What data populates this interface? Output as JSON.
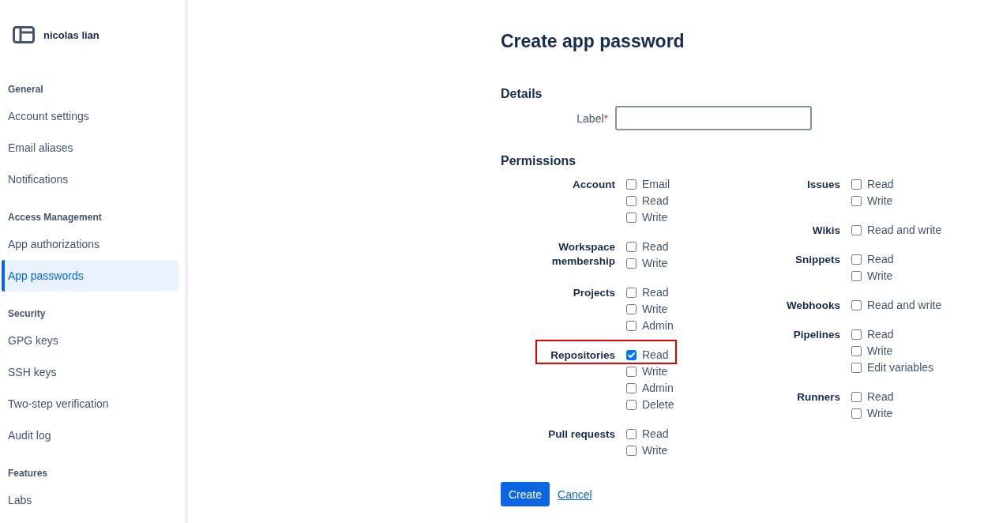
{
  "sidebar": {
    "user": {
      "name": "nicolas lian"
    },
    "sections": [
      {
        "title": "General",
        "items": [
          {
            "label": "Account settings",
            "selected": false
          },
          {
            "label": "Email aliases",
            "selected": false
          },
          {
            "label": "Notifications",
            "selected": false
          }
        ]
      },
      {
        "title": "Access Management",
        "items": [
          {
            "label": "App authorizations",
            "selected": false
          },
          {
            "label": "App passwords",
            "selected": true
          }
        ]
      },
      {
        "title": "Security",
        "items": [
          {
            "label": "GPG keys",
            "selected": false
          },
          {
            "label": "SSH keys",
            "selected": false
          },
          {
            "label": "Two-step verification",
            "selected": false
          },
          {
            "label": "Audit log",
            "selected": false
          }
        ]
      },
      {
        "title": "Features",
        "items": [
          {
            "label": "Labs",
            "selected": false
          }
        ]
      }
    ]
  },
  "form": {
    "title": "Create app password",
    "details": {
      "heading": "Details",
      "field": {
        "label": "Label",
        "required_mark": "*"
      }
    },
    "permissions": {
      "heading": "Permissions",
      "columns": [
        {
          "groups": [
            {
              "name": "Account",
              "highlighted": false,
              "options": [
                {
                  "label": "Email",
                  "checked": false
                },
                {
                  "label": "Read",
                  "checked": false
                },
                {
                  "label": "Write",
                  "checked": false
                }
              ]
            },
            {
              "name": "Workspace membership",
              "highlighted": false,
              "options": [
                {
                  "label": "Read",
                  "checked": false
                },
                {
                  "label": "Write",
                  "checked": false
                }
              ]
            },
            {
              "name": "Projects",
              "highlighted": false,
              "options": [
                {
                  "label": "Read",
                  "checked": false
                },
                {
                  "label": "Write",
                  "checked": false
                },
                {
                  "label": "Admin",
                  "checked": false
                }
              ]
            },
            {
              "name": "Repositories",
              "highlighted": true,
              "options": [
                {
                  "label": "Read",
                  "checked": true
                },
                {
                  "label": "Write",
                  "checked": false
                },
                {
                  "label": "Admin",
                  "checked": false
                },
                {
                  "label": "Delete",
                  "checked": false
                }
              ]
            },
            {
              "name": "Pull requests",
              "highlighted": false,
              "options": [
                {
                  "label": "Read",
                  "checked": false
                },
                {
                  "label": "Write",
                  "checked": false
                }
              ]
            }
          ]
        },
        {
          "groups": [
            {
              "name": "Issues",
              "highlighted": false,
              "options": [
                {
                  "label": "Read",
                  "checked": false
                },
                {
                  "label": "Write",
                  "checked": false
                }
              ]
            },
            {
              "name": "Wikis",
              "highlighted": false,
              "options": [
                {
                  "label": "Read and write",
                  "checked": false
                }
              ]
            },
            {
              "name": "Snippets",
              "highlighted": false,
              "options": [
                {
                  "label": "Read",
                  "checked": false
                },
                {
                  "label": "Write",
                  "checked": false
                }
              ]
            },
            {
              "name": "Webhooks",
              "highlighted": false,
              "options": [
                {
                  "label": "Read and write",
                  "checked": false
                }
              ]
            },
            {
              "name": "Pipelines",
              "highlighted": false,
              "options": [
                {
                  "label": "Read",
                  "checked": false
                },
                {
                  "label": "Write",
                  "checked": false
                },
                {
                  "label": "Edit variables",
                  "checked": false
                }
              ]
            },
            {
              "name": "Runners",
              "highlighted": false,
              "options": [
                {
                  "label": "Read",
                  "checked": false
                },
                {
                  "label": "Write",
                  "checked": false
                }
              ]
            }
          ]
        }
      ]
    },
    "buttons": [
      {
        "label": "Create",
        "kind": "primary"
      },
      {
        "label": "Cancel",
        "kind": "link"
      }
    ]
  }
}
